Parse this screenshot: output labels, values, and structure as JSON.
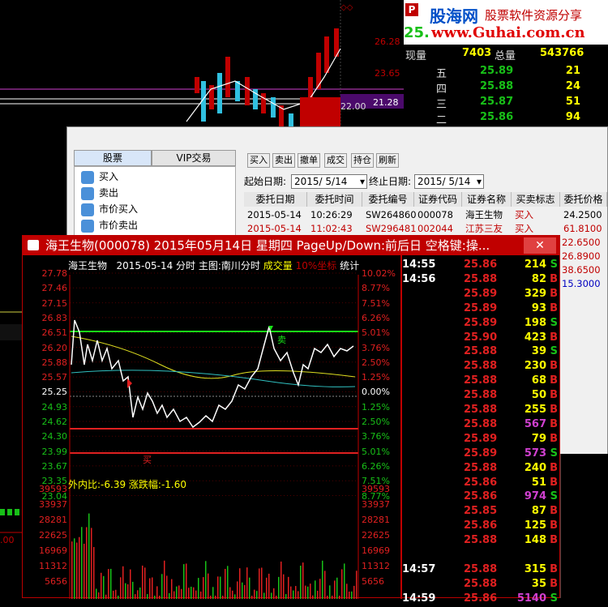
{
  "watermark": {
    "brand": "股海网",
    "slogan": "股票软件资源分享",
    "url": "www.Guhai.com.cn"
  },
  "bg_chart": {
    "price_labels": [
      "26.28",
      "23.65",
      "21.28",
      "22.00"
    ],
    "quote_price": "25.",
    "quote_now_label": "现量",
    "quote_now": "7403",
    "quote_total_label": "总量",
    "quote_total": "543766",
    "asks": [
      {
        "label": "五",
        "price": "25.89",
        "vol": "21"
      },
      {
        "label": "四",
        "price": "25.88",
        "vol": "24"
      },
      {
        "label": "三",
        "price": "25.87",
        "vol": "51"
      },
      {
        "label": "二",
        "price": "25.86",
        "vol": "94"
      }
    ]
  },
  "trade": {
    "tabs": [
      "股票",
      "VIP交易"
    ],
    "tree": [
      "买入",
      "卖出",
      "市价买入",
      "市价卖出"
    ],
    "toolbar": [
      "买入",
      "卖出",
      "撤单",
      "成交",
      "持仓",
      "刷新"
    ],
    "start_label": "起始日期:",
    "start_date": "2015/ 5/14",
    "end_label": "终止日期:",
    "end_date": "2015/ 5/14",
    "columns": [
      "委托日期",
      "委托时间",
      "委托编号",
      "证券代码",
      "证券名称",
      "买卖标志",
      "委托价格"
    ],
    "rows": [
      [
        "2015-05-14",
        "10:26:29",
        "SW264860",
        "000078",
        "海王生物",
        "买入",
        "24.2500"
      ],
      [
        "2015-05-14",
        "11:02:43",
        "SW296481",
        "002044",
        "江苏三友",
        "买入",
        "61.8100"
      ]
    ],
    "extra_prices": [
      "22.6500",
      "26.8900",
      "38.6500",
      "15.3000"
    ]
  },
  "detail": {
    "title": "海王生物(000078) 2015年05月14日 星期四 PageUp/Down:前后日 空格键:操...",
    "chart_header": {
      "name": "海王生物",
      "info": "2015-05-14 分时 主图:南川分时",
      "vol_label": "成交量",
      "pct": "10%坐标",
      "ref": "统计"
    },
    "price_axis": [
      "27.78",
      "27.46",
      "27.15",
      "26.83",
      "26.51",
      "26.20",
      "25.88",
      "25.57",
      "25.25",
      "24.93",
      "24.62",
      "24.30",
      "23.99",
      "23.67",
      "23.35",
      "23.04"
    ],
    "pct_axis": [
      "10.02%",
      "8.77%",
      "7.51%",
      "6.26%",
      "5.01%",
      "3.76%",
      "2.50%",
      "1.25%",
      "0.00%",
      "1.25%",
      "2.50%",
      "3.76%",
      "5.01%",
      "6.26%",
      "7.51%",
      "8.77%"
    ],
    "buy_label": "买",
    "sell_label": "卖",
    "vol_header": {
      "ratio": "外内比:-6.39",
      "change": "涨跌幅:-1.60"
    },
    "vol_axis": [
      "39593",
      "33937",
      "28281",
      "22625",
      "16969",
      "11312",
      "5656"
    ],
    "ticks": [
      {
        "t": "14:55",
        "p": "25.86",
        "v": "214",
        "s": "S"
      },
      {
        "t": "14:56",
        "p": "25.88",
        "v": "82",
        "s": "B"
      },
      {
        "t": "",
        "p": "25.89",
        "v": "329",
        "s": "B"
      },
      {
        "t": "",
        "p": "25.89",
        "v": "93",
        "s": "B"
      },
      {
        "t": "",
        "p": "25.89",
        "v": "198",
        "s": "S"
      },
      {
        "t": "",
        "p": "25.90",
        "v": "423",
        "s": "B"
      },
      {
        "t": "",
        "p": "25.88",
        "v": "39",
        "s": "S"
      },
      {
        "t": "",
        "p": "25.88",
        "v": "230",
        "s": "B"
      },
      {
        "t": "",
        "p": "25.88",
        "v": "68",
        "s": "B"
      },
      {
        "t": "",
        "p": "25.88",
        "v": "50",
        "s": "B"
      },
      {
        "t": "",
        "p": "25.88",
        "v": "255",
        "s": "B"
      },
      {
        "t": "",
        "p": "25.88",
        "v": "567",
        "s": "B"
      },
      {
        "t": "",
        "p": "25.89",
        "v": "79",
        "s": "B"
      },
      {
        "t": "",
        "p": "25.89",
        "v": "573",
        "s": "S"
      },
      {
        "t": "",
        "p": "25.88",
        "v": "240",
        "s": "B"
      },
      {
        "t": "",
        "p": "25.86",
        "v": "51",
        "s": "B"
      },
      {
        "t": "",
        "p": "25.86",
        "v": "974",
        "s": "S"
      },
      {
        "t": "",
        "p": "25.85",
        "v": "87",
        "s": "B"
      },
      {
        "t": "",
        "p": "25.86",
        "v": "125",
        "s": "B"
      },
      {
        "t": "",
        "p": "25.88",
        "v": "148",
        "s": "B"
      },
      {
        "t": "14:57",
        "p": "25.88",
        "v": "315",
        "s": "B"
      },
      {
        "t": "",
        "p": "25.88",
        "v": "35",
        "s": "B"
      },
      {
        "t": "14:59",
        "p": "25.86",
        "v": "5140",
        "s": "S"
      }
    ]
  }
}
